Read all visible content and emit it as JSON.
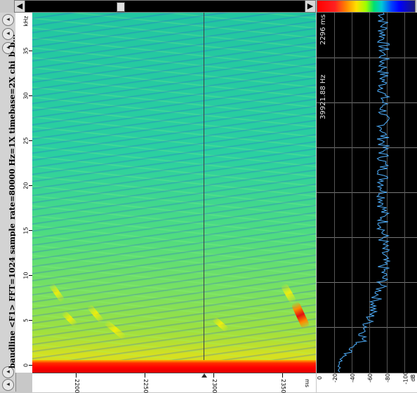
{
  "window": {
    "vertical_title": "baudline <F1> FFT=1024 sample_rate=80000 Hz=1X timebase=2X chi_b_b...",
    "left_buttons": [
      "◂",
      "◂",
      "◂",
      "◂",
      "◂",
      "◂"
    ]
  },
  "scrollbar": {
    "left_arrow": "◀",
    "right_arrow": "▶"
  },
  "freq_axis": {
    "unit": "kHz",
    "labels": [
      "35",
      "30",
      "25",
      "20",
      "15",
      "10",
      "5",
      "0"
    ]
  },
  "time_axis": {
    "unit": "ms",
    "labels": [
      "2200",
      "2250",
      "2300",
      "2350"
    ]
  },
  "spectrum": {
    "time_readout": "2296 ms",
    "freq_readout": "39921.88 Hz"
  },
  "db_axis": {
    "labels": [
      "0",
      "-20",
      "-40",
      "-60",
      "-80",
      "-100"
    ],
    "unit": "dB"
  },
  "colors": {
    "spectrogram_bg": "#22c6a0",
    "trace": "#4fb0ff",
    "panel_bg": "#000000"
  }
}
